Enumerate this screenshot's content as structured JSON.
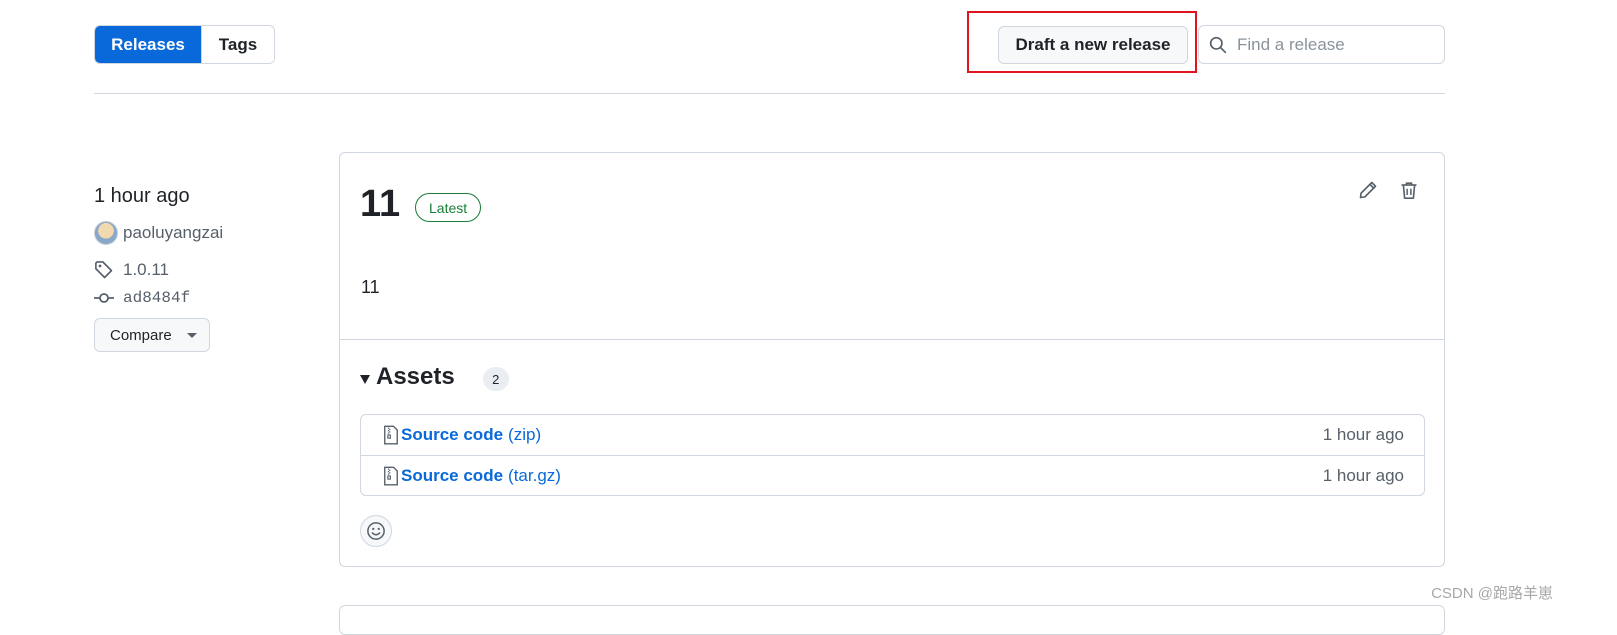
{
  "tabs": {
    "releases": "Releases",
    "tags": "Tags"
  },
  "toolbar": {
    "draft_button": "Draft a new release",
    "search_placeholder": "Find a release"
  },
  "release": {
    "time_ago": "1 hour ago",
    "author": "paoluyangzai",
    "tag": "1.0.11",
    "commit": "ad8484f",
    "compare_label": "Compare",
    "title": "11",
    "badge": "Latest",
    "body": "11",
    "assets": {
      "label": "Assets",
      "count": "2",
      "items": [
        {
          "name": "Source code",
          "ext": "(zip)",
          "time": "1 hour ago"
        },
        {
          "name": "Source code",
          "ext": "(tar.gz)",
          "time": "1 hour ago"
        }
      ]
    }
  },
  "watermark": "CSDN @跑路羊崽",
  "colors": {
    "accent": "#0969da",
    "latest_green": "#1a7f37",
    "highlight_red": "#e0141e",
    "border": "#d0d7de"
  }
}
